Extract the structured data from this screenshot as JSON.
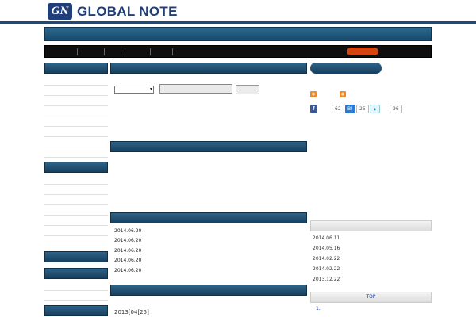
{
  "header": {
    "logo_mark": "GN",
    "logo_text": "GLOBAL NOTE",
    "tagline": "",
    "tagline_red": ""
  },
  "banner": {
    "text": ""
  },
  "nav": {
    "items": [
      "",
      "",
      "",
      "",
      ""
    ],
    "login": "",
    "register_text": "",
    "register_highlight": ""
  },
  "sidebar": {
    "section1": {
      "title": "",
      "items": [
        "",
        "",
        "",
        "",
        "",
        "",
        "",
        ""
      ]
    },
    "section2": {
      "title": "",
      "items": [
        "",
        "",
        "",
        "",
        "",
        "",
        ""
      ]
    },
    "section3": {
      "title": ""
    },
    "section4": {
      "title": "",
      "items": [
        "",
        ""
      ]
    },
    "section5": {
      "title": ""
    }
  },
  "search": {
    "bar_title": "",
    "bar_right": "",
    "label": "",
    "select_value": "",
    "input_placeholder": "",
    "button_label": "",
    "links": [
      "",
      "",
      "",
      "",
      "",
      "",
      "",
      "",
      "",
      "",
      ""
    ]
  },
  "categories": {
    "bar_title": "",
    "bar_right": "",
    "links": [
      "",
      "",
      "",
      "",
      "",
      "",
      "",
      "",
      "",
      "",
      "",
      "",
      "",
      "",
      "",
      "",
      "",
      "",
      "",
      "",
      "",
      "",
      "",
      ""
    ]
  },
  "news": {
    "bar_title": "",
    "bar_right": "",
    "items": [
      {
        "text": "",
        "date": "2014.06.20"
      },
      {
        "text": "",
        "date": "2014.06.20"
      },
      {
        "text": "",
        "date": "2014.06.20"
      },
      {
        "text": "",
        "date": "2014.06.20"
      },
      {
        "text": "",
        "date": "2014.06.20"
      }
    ]
  },
  "article": {
    "bar_title": "",
    "title": "",
    "date": "2013[04[25]"
  },
  "right": {
    "register_label": "",
    "price": "",
    "rss": [
      "",
      ""
    ],
    "social": {
      "fb_label": "",
      "fb_count": "62",
      "hatena_label": "B!",
      "hatena_count": "25",
      "tw_label": "",
      "tw_count": "96"
    },
    "panel1_title": "",
    "panel1_items": [
      {
        "text": "",
        "date": "2014.06.11"
      },
      {
        "text": "",
        "date": "2014.05.16"
      },
      {
        "text": "",
        "date": "2014.02.22"
      },
      {
        "text": "",
        "date": "2014.02.22"
      },
      {
        "text": "",
        "date": "2013.12.22"
      }
    ],
    "panel2_title": "TOP",
    "panel2_item": "1."
  },
  "colors": {
    "brand": "#1f4a7e",
    "accent": "#cc0000",
    "link": "#003399",
    "nav_active": "#4ddf4d"
  }
}
